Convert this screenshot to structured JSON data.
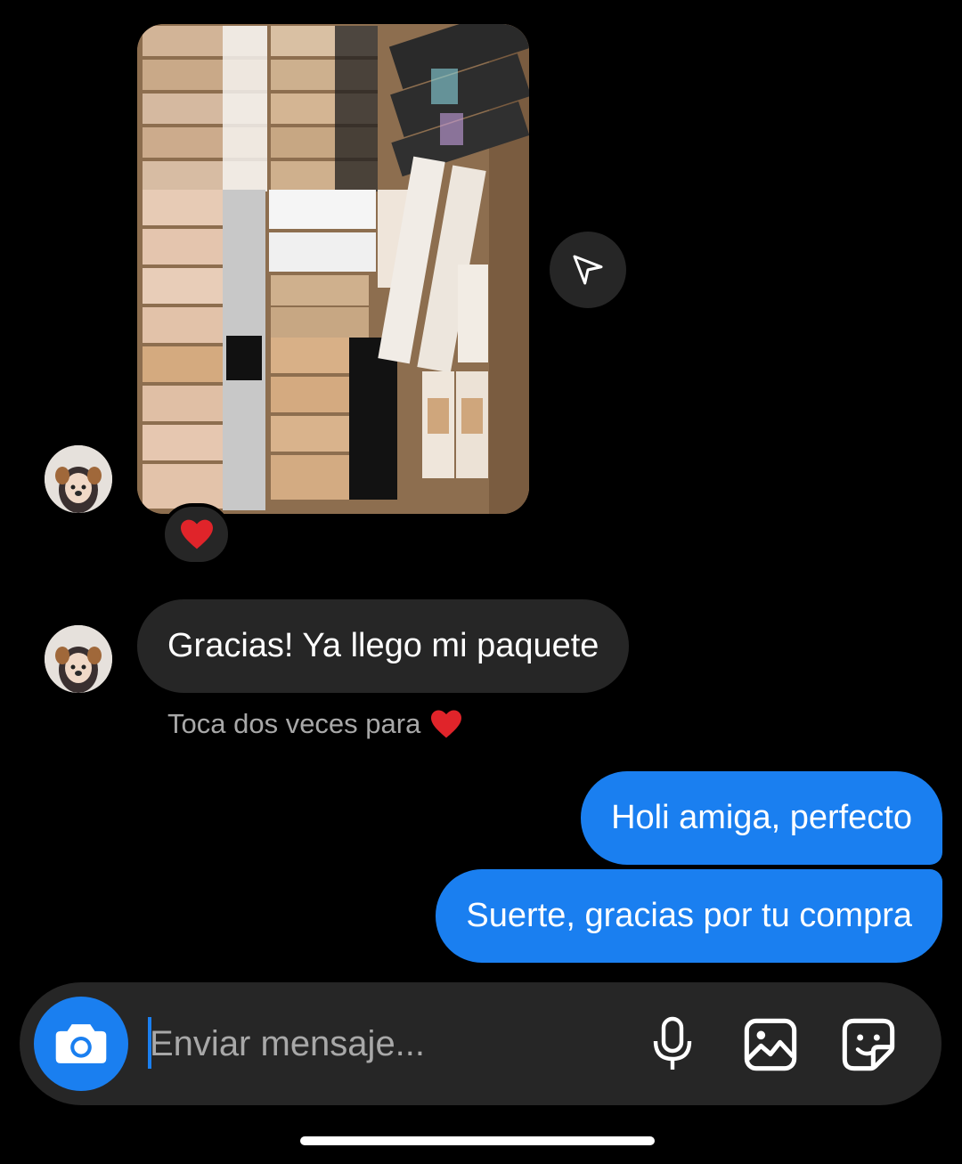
{
  "thread": {
    "received_image": {
      "reaction_emoji": "❤️"
    },
    "received_message": {
      "text": "Gracias! Ya llego mi paquete"
    },
    "double_tap_hint": {
      "text": "Toca dos veces para",
      "emoji": "❤️"
    },
    "sent_messages": [
      {
        "text": "Holi amiga, perfecto"
      },
      {
        "text": "Suerte, gracias por tu compra"
      }
    ]
  },
  "composer": {
    "placeholder": "Enviar mensaje...",
    "icons": [
      "camera-icon",
      "microphone-icon",
      "gallery-icon",
      "sticker-icon"
    ]
  },
  "colors": {
    "accent": "#1a7ff0",
    "bubble_received": "#262626",
    "background": "#000000",
    "heart": "#e0242a"
  }
}
